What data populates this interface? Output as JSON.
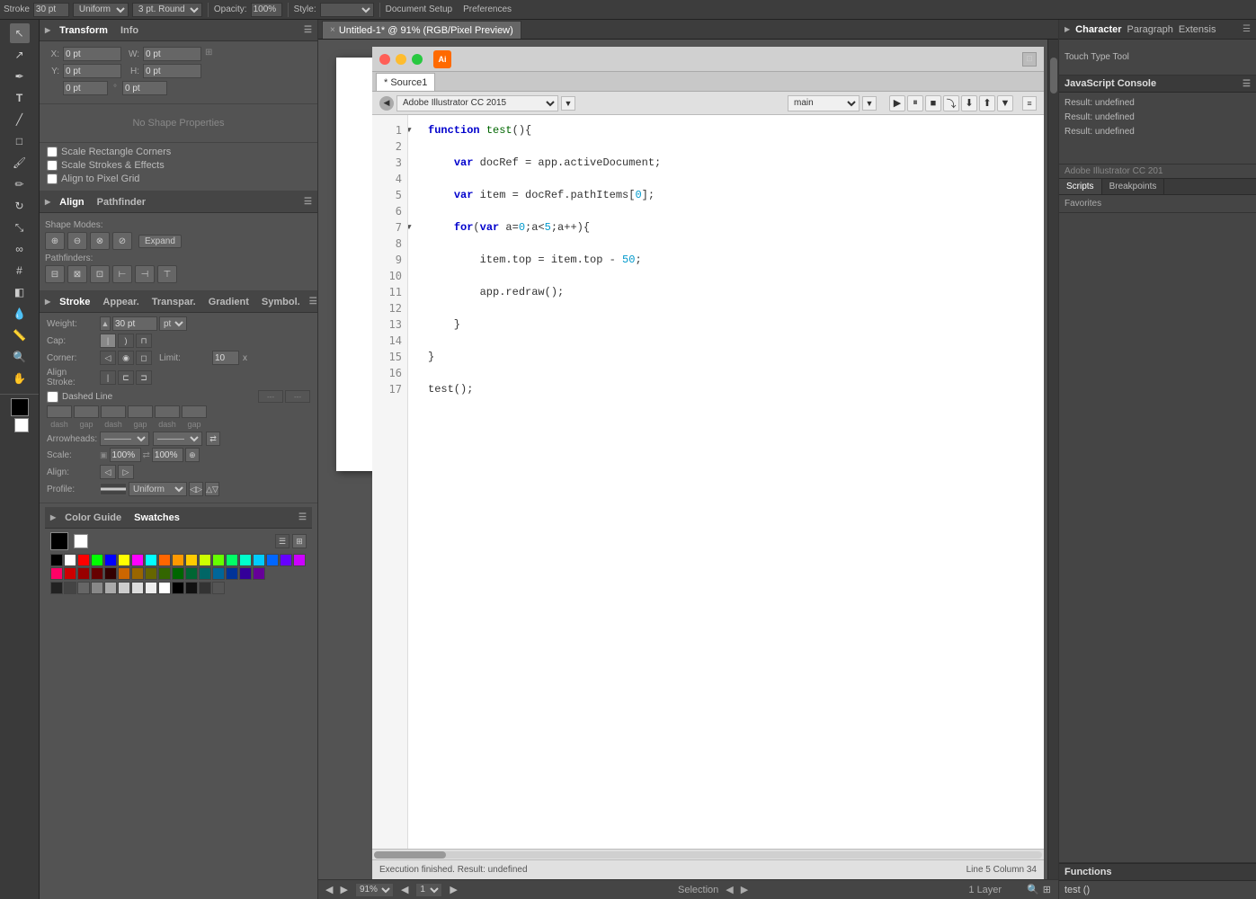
{
  "app": {
    "title": "Adobe Illustrator",
    "doc_tab": "Untitled-1* @ 91% (RGB/Pixel Preview)"
  },
  "top_toolbar": {
    "stroke_label": "Stroke",
    "stroke_value": "30 pt",
    "uniform_label": "Uniform",
    "round_label": "3 pt. Round",
    "opacity_label": "Opacity:",
    "opacity_value": "100%",
    "style_label": "Style:",
    "doc_setup": "Document Setup",
    "preferences": "Preferences"
  },
  "left_panel": {
    "transform_tab": "Transform",
    "info_tab": "Info",
    "x_label": "X:",
    "x_value": "0 pt",
    "y_label": "Y:",
    "y_value": "0 pt",
    "w_label": "W:",
    "w_value": "0 pt",
    "h_label": "H:",
    "h_value": "0 pt",
    "no_shape": "No Shape Properties",
    "scale_rect_corners": "Scale Rectangle Corners",
    "scale_strokes_effects": "Scale Strokes & Effects",
    "align_pixel_grid": "Align to Pixel Grid"
  },
  "align_panel": {
    "align_tab": "Align",
    "pathfinder_tab": "Pathfinder",
    "shape_modes_label": "Shape Modes:",
    "expand_label": "Expand",
    "pathfinders_label": "Pathfinders:"
  },
  "stroke_panel": {
    "stroke_tab": "Stroke",
    "appear_tab": "Appear.",
    "transpar_tab": "Transpar.",
    "gradient_tab": "Gradient",
    "symbol_tab": "Symbol.",
    "weight_label": "Weight:",
    "weight_value": "30 pt",
    "cap_label": "Cap:",
    "corner_label": "Corner:",
    "limit_label": "Limit:",
    "limit_value": "10",
    "align_stroke_label": "Align Stroke:",
    "dashed_line_label": "Dashed Line",
    "dash_label": "dash",
    "gap_label": "gap",
    "arrowheads_label": "Arrowheads:",
    "scale_label": "Scale:",
    "scale_value1": "100%",
    "scale_value2": "100%",
    "align_label": "Align:",
    "profile_label": "Profile:",
    "profile_value": "Uniform"
  },
  "color_panel": {
    "color_guide_tab": "Color Guide",
    "swatches_tab": "Swatches"
  },
  "script_editor": {
    "title": "Adobe Illustrator CC 2015",
    "source_tab": "* Source1",
    "run_label": "main",
    "code_lines": [
      {
        "num": 1,
        "fold": true,
        "text": "function test(){"
      },
      {
        "num": 2,
        "text": ""
      },
      {
        "num": 3,
        "text": "    var docRef = app.activeDocument;"
      },
      {
        "num": 4,
        "text": ""
      },
      {
        "num": 5,
        "text": "    var item = docRef.pathItems[0];"
      },
      {
        "num": 6,
        "text": ""
      },
      {
        "num": 7,
        "fold": true,
        "text": "    for(var a=0;a<5;a++){"
      },
      {
        "num": 8,
        "text": ""
      },
      {
        "num": 9,
        "text": "        item.top = item.top - 50;"
      },
      {
        "num": 10,
        "text": ""
      },
      {
        "num": 11,
        "text": "        app.redraw();"
      },
      {
        "num": 12,
        "text": ""
      },
      {
        "num": 13,
        "text": "    }"
      },
      {
        "num": 14,
        "fold_end": true,
        "text": ""
      },
      {
        "num": 15,
        "text": "}"
      },
      {
        "num": 16,
        "text": ""
      },
      {
        "num": 17,
        "text": "test();"
      }
    ],
    "status_left": "Execution finished. Result: undefined",
    "status_right": "Line 5   Column 34"
  },
  "js_console": {
    "title": "JavaScript Console",
    "results": [
      "Result: undefined",
      "Result: undefined",
      "Result: undefined"
    ],
    "ai_version": "Adobe Illustrator CC 201"
  },
  "scripts_panel": {
    "scripts_tab": "Scripts",
    "breakpoints_tab": "Breakpoints",
    "favorites_label": "Favorites",
    "functions_label": "Functions",
    "function_items": [
      "test ()"
    ]
  },
  "char_panel": {
    "character_tab": "Character",
    "paragraph_tab": "Paragraph",
    "extensions_tab": "Extensis",
    "touch_type": "Touch Type Tool"
  },
  "bottom_bar": {
    "zoom_value": "91%",
    "layer_label": "1 Layer",
    "selection_label": "Selection"
  },
  "icons": {
    "fold": "▶",
    "unfold": "▼",
    "close": "×",
    "arrow_right": "▶",
    "arrow_left": "◀",
    "arrow_down": "▼",
    "play": "▶",
    "pause": "⏸",
    "stop": "■",
    "step_over": "⤵",
    "step_into": "⬇",
    "step_out": "⬆",
    "swap": "⇄",
    "link": "🔗",
    "settings": "☰",
    "grid": "⊞",
    "list": "☰"
  },
  "swatches": {
    "colors": [
      "#000000",
      "#ffffff",
      "#ff0000",
      "#00ff00",
      "#0000ff",
      "#ffff00",
      "#ff00ff",
      "#00ffff",
      "#ff6600",
      "#ff9900",
      "#ffcc00",
      "#ccff00",
      "#66ff00",
      "#00ff66",
      "#00ffcc",
      "#00ccff",
      "#0066ff",
      "#6600ff",
      "#cc00ff",
      "#ff0066",
      "#cc0000",
      "#990000",
      "#660000",
      "#330000",
      "#cc6600",
      "#996600",
      "#666600",
      "#336600",
      "#006600",
      "#006633",
      "#006666",
      "#006699",
      "#003399",
      "#330099",
      "#660099",
      "#990066",
      "#808080",
      "#999999",
      "#aaaaaa",
      "#bbbbbb"
    ]
  }
}
